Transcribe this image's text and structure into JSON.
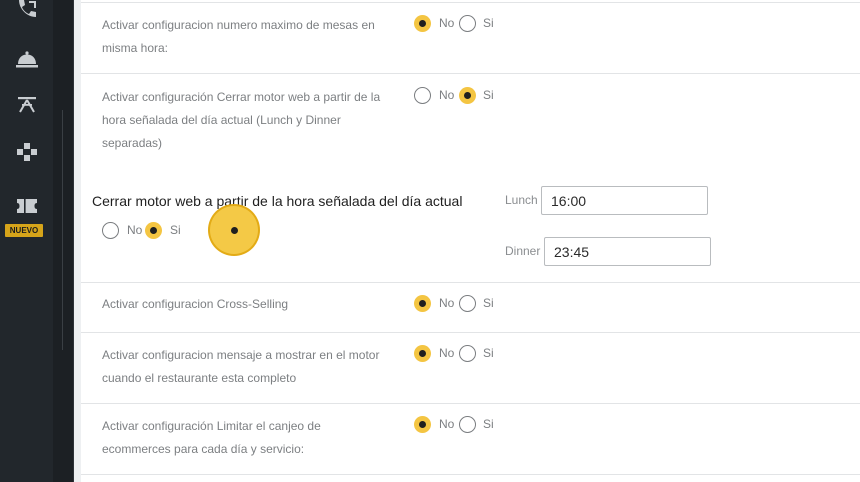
{
  "sidebar": {
    "icons": [
      "phone-icon",
      "cloche-icon",
      "table-icon",
      "puzzle-icon",
      "ticket-icon"
    ],
    "badge": "NUEVO"
  },
  "settings": [
    {
      "label_lines": [
        "Activar configuracion numero maximo de mesas en",
        "misma hora:"
      ],
      "no": "No",
      "si": "Si",
      "value": "No"
    },
    {
      "label_lines": [
        "Activar configuración Cerrar motor web a partir de la",
        "hora señalada del día actual (Lunch y Dinner",
        "separadas)"
      ],
      "no": "No",
      "si": "Si",
      "value": "Si"
    },
    {
      "label_lines": [
        "Activar configuracion Cross-Selling"
      ],
      "no": "No",
      "si": "Si",
      "value": "No"
    },
    {
      "label_lines": [
        "Activar configuracion mensaje a mostrar en el motor",
        "cuando el restaurante esta completo"
      ],
      "no": "No",
      "si": "Si",
      "value": "No"
    },
    {
      "label_lines": [
        "Activar configuración Limitar el canjeo de",
        "ecommerces para cada día y servicio:"
      ],
      "no": "No",
      "si": "Si",
      "value": "No"
    }
  ],
  "close_motor": {
    "title": "Cerrar motor web a partir de la hora señalada del día actual",
    "no": "No",
    "si": "Si",
    "value": "Si",
    "lunch_label": "Lunch",
    "lunch_value": "16:00",
    "dinner_label": "Dinner",
    "dinner_value": "23:45"
  },
  "colors": {
    "accent": "#f4c542",
    "sidebar": "#22272c",
    "badge": "#d6a41a"
  }
}
